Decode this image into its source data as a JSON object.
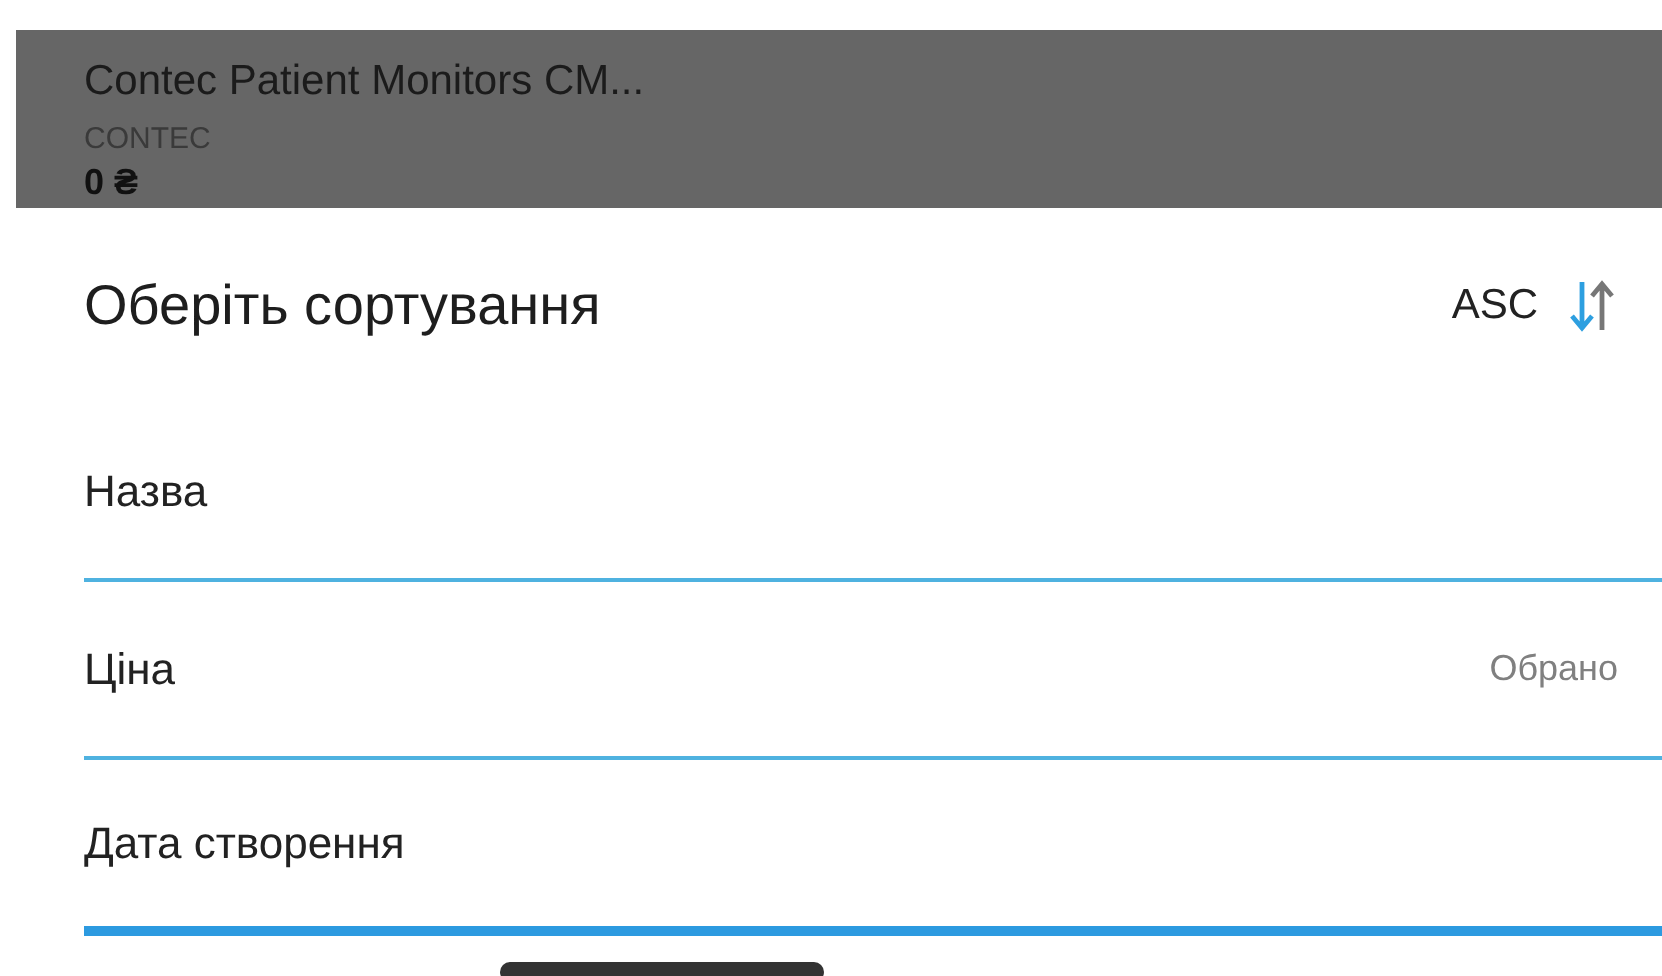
{
  "background_product": {
    "name": "Contec Patient Monitors CM...",
    "brand": "CONTEC",
    "price": "0 ₴"
  },
  "sort_sheet": {
    "title": "Оберіть сортування",
    "direction_label": "ASC",
    "ascending": true,
    "selected_label": "Обрано",
    "options": [
      {
        "label": "Назва",
        "selected": false,
        "focused": false
      },
      {
        "label": "Ціна",
        "selected": true,
        "focused": false
      },
      {
        "label": "Дата створення",
        "selected": false,
        "focused": true
      }
    ]
  }
}
